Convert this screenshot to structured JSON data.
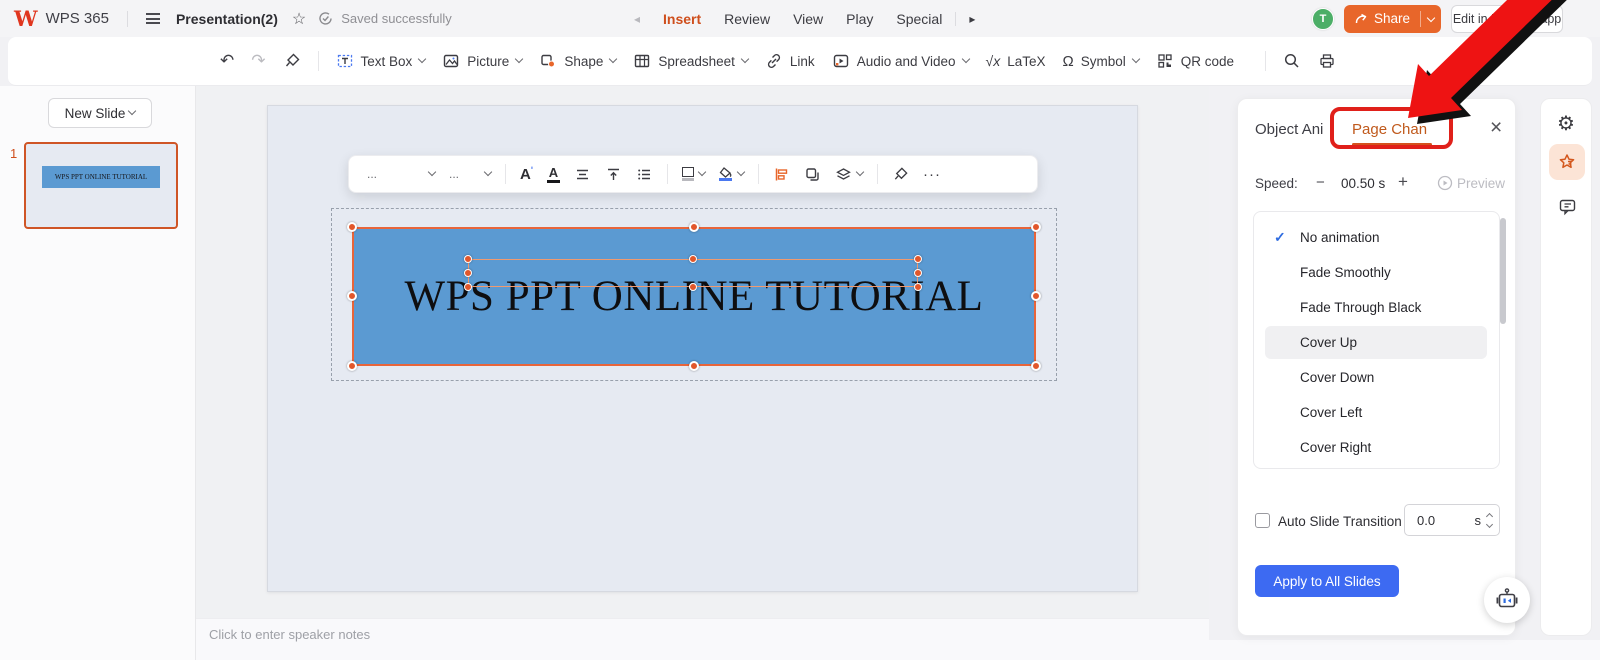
{
  "topbar": {
    "brand": "WPS 365",
    "doc_title": "Presentation(2)",
    "save_status": "Saved successfully",
    "menu": {
      "items": [
        "Insert",
        "Review",
        "View",
        "Play",
        "Special"
      ],
      "active": "Insert"
    },
    "avatar_initial": "T",
    "share_label": "Share",
    "edit_app_label": "Edit in Desktop app"
  },
  "toolbar": {
    "undo_icon": "↶",
    "redo_icon": "↷",
    "buttons": [
      {
        "label": "Text Box",
        "dropdown": true
      },
      {
        "label": "Picture",
        "dropdown": true
      },
      {
        "label": "Shape",
        "dropdown": true
      },
      {
        "label": "Spreadsheet",
        "dropdown": true
      },
      {
        "label": "Link",
        "dropdown": false
      },
      {
        "label": "Audio and Video",
        "dropdown": true
      },
      {
        "label": "LaTeX",
        "dropdown": false
      },
      {
        "label": "Symbol",
        "dropdown": true
      },
      {
        "label": "QR code",
        "dropdown": false
      }
    ],
    "latex_glyph": "√x",
    "symbol_glyph": "Ω"
  },
  "slides_panel": {
    "new_slide_label": "New Slide",
    "slide_number": "1",
    "thumb_title": "WPS PPT ONLINE TUTORIAL"
  },
  "canvas": {
    "title": "WPS PPT ONLINE TUTORIAL",
    "notes_placeholder": "Click to enter speaker notes"
  },
  "float_toolbar": {
    "font_value": "...",
    "size_value": "...",
    "more": "···"
  },
  "right_panel": {
    "tabs": {
      "object": "Object Ani",
      "page": "Page Chan"
    },
    "close_glyph": "×",
    "speed": {
      "label": "Speed:",
      "minus": "−",
      "value": "00.50 s",
      "plus": "+",
      "preview": "Preview"
    },
    "animations": [
      "No animation",
      "Fade Smoothly",
      "Fade Through Black",
      "Cover Up",
      "Cover Down",
      "Cover Left",
      "Cover Right"
    ],
    "selected_animation": "No animation",
    "selected_check": "✓",
    "highlighted_animation": "Cover Up",
    "auto": {
      "label": "Auto Slide Transition",
      "value": "0.0",
      "unit": "s"
    },
    "apply_label": "Apply to All Slides"
  },
  "colors": {
    "accent_orange": "#cf4f1d",
    "share_orange": "#e8662a",
    "avatar_green": "#4cae67",
    "textbox_blue": "#5b9ad2",
    "selection_orange": "#e8653a",
    "annotation_red": "#e0201a",
    "apply_blue": "#3d6af2",
    "check_blue": "#2f6ce0"
  }
}
